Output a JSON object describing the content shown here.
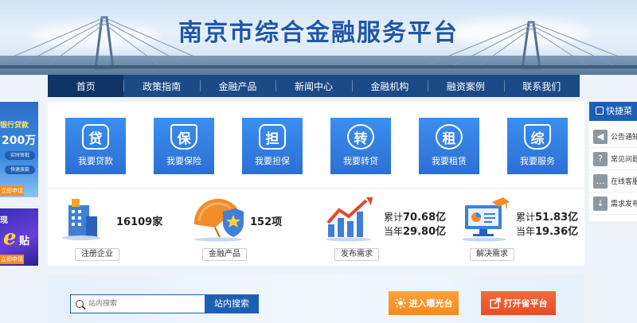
{
  "header": {
    "site_title": "南京市综合金融服务平台"
  },
  "nav": {
    "items": [
      {
        "label": "首页",
        "active": true
      },
      {
        "label": "政策指南"
      },
      {
        "label": "金融产品"
      },
      {
        "label": "新闻中心"
      },
      {
        "label": "金融机构"
      },
      {
        "label": "融资案例"
      },
      {
        "label": "联系我们"
      }
    ]
  },
  "left_ads": {
    "ad1": {
      "line1": "银行贷款",
      "line2": "200万",
      "pill1": "实时审批",
      "pill2": "快速放款",
      "apply": "立即申请"
    },
    "ad2": {
      "line1": "现",
      "e_glyph": "e",
      "line2": "贴",
      "apply": "立即申请"
    }
  },
  "services": [
    {
      "glyph": "贷",
      "label": "我要贷款",
      "icon": "loan-icon"
    },
    {
      "glyph": "保",
      "label": "我要保险",
      "icon": "insurance-icon"
    },
    {
      "glyph": "担",
      "label": "我要担保",
      "icon": "guarantee-icon"
    },
    {
      "glyph": "转",
      "label": "我要转贷",
      "icon": "transfer-loan-icon"
    },
    {
      "glyph": "租",
      "label": "我要租赁",
      "icon": "lease-icon"
    },
    {
      "glyph": "综",
      "label": "我要服务",
      "icon": "service-icon"
    }
  ],
  "stats": {
    "enterprises": {
      "value": "16109家",
      "tag": "注册企业"
    },
    "products": {
      "value": "152项",
      "tag": "金融产品"
    },
    "demands": {
      "total_label": "累计",
      "total": "70.68亿",
      "year_label": "当年",
      "year": "29.80亿",
      "tag": "发布需求"
    },
    "resolved": {
      "total_label": "累计",
      "total": "51.83亿",
      "year_label": "当年",
      "year": "19.36亿",
      "tag": "解决需求"
    }
  },
  "quick_menu": {
    "title": "快捷菜",
    "items": [
      {
        "glyph": "◀",
        "label": "公告通知",
        "icon": "megaphone-icon"
      },
      {
        "glyph": "?",
        "label": "常见问题",
        "icon": "question-icon"
      },
      {
        "glyph": "…",
        "label": "在线客服",
        "icon": "chat-icon"
      },
      {
        "glyph": "↓",
        "label": "需求发布",
        "icon": "download-icon"
      }
    ]
  },
  "search": {
    "placeholder": "站内搜索",
    "button_label": "站内搜索"
  },
  "actions": {
    "exposure_label": "进入曝光台",
    "province_label": "打开省平台"
  },
  "colors": {
    "brand_blue": "#1d5fb3",
    "nav_blue": "#1c4a86",
    "accent_orange": "#f58a1f",
    "accent_red": "#e54c26"
  }
}
